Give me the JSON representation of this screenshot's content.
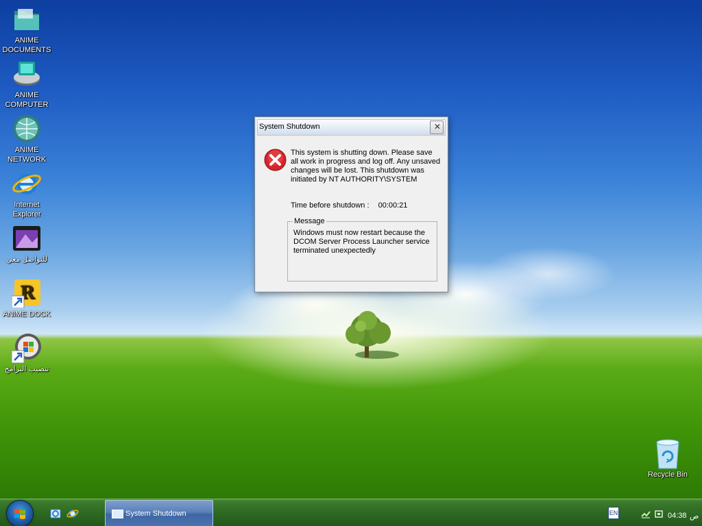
{
  "desktop": {
    "icons": [
      {
        "label": "ANIME\nDOCUMENTS",
        "icon": "folder-icon"
      },
      {
        "label": "ANIME\nCOMPUTER",
        "icon": "computer-icon"
      },
      {
        "label": "ANIME\nNETWORK",
        "icon": "network-globe-icon"
      },
      {
        "label": "Internet\nExplorer",
        "icon": "internet-explorer-icon"
      },
      {
        "label": "للتواصل معي",
        "icon": "contact-folder-icon"
      },
      {
        "label": "ANIME DOCK",
        "icon": "anime-dock-shortcut-icon"
      },
      {
        "label": "تنصيب البرامج",
        "icon": "install-programs-shortcut-icon"
      }
    ],
    "recycle_bin": {
      "label": "Recycle Bin",
      "icon": "recycle-bin-icon"
    }
  },
  "dialog": {
    "title": "System Shutdown",
    "close_glyph": "✕",
    "message": "This system is shutting down. Please save all work in progress and log off. Any unsaved changes will be lost. This shutdown was initiated by NT AUTHORITY\\SYSTEM",
    "time_label": "Time before shutdown :",
    "time_value": "00:00:21",
    "group_label": "Message",
    "group_text": "Windows must now restart because the DCOM Server Process Launcher service terminated unexpectedly"
  },
  "taskbar": {
    "quick_launch": [
      "show-desktop-icon",
      "internet-explorer-icon"
    ],
    "task_button_label": "System Shutdown",
    "language": "EN",
    "clock": "04:38",
    "ampm": "ص"
  },
  "colors": {
    "taskbar": "#2f6b24",
    "dialog_bg": "#f0f0f0",
    "task_button": "#4a73b0",
    "error_red": "#d8232a"
  }
}
